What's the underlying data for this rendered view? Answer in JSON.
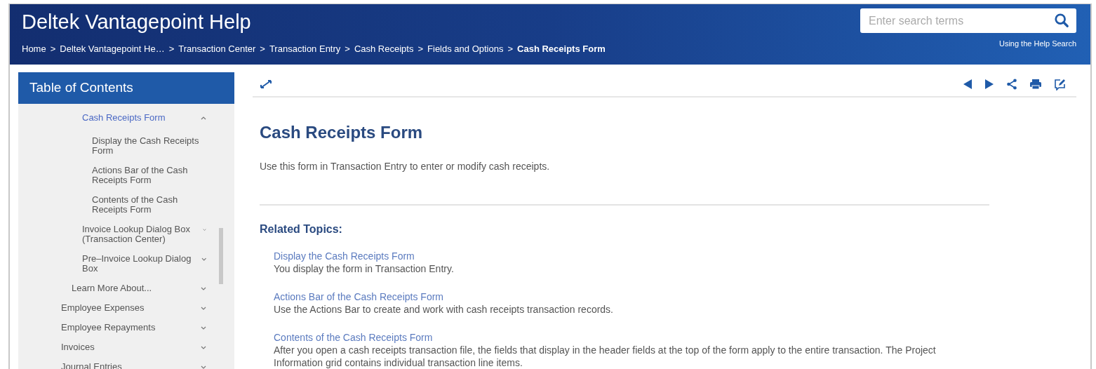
{
  "header": {
    "title": "Deltek Vantagepoint Help",
    "search": {
      "placeholder": "Enter search terms"
    },
    "search_help_link": "Using the Help Search"
  },
  "breadcrumbs": [
    {
      "label": "Home",
      "current": false
    },
    {
      "label": "Deltek Vantagepoint He…",
      "current": false
    },
    {
      "label": "Transaction Center",
      "current": false
    },
    {
      "label": "Transaction Entry",
      "current": false
    },
    {
      "label": "Cash Receipts",
      "current": false
    },
    {
      "label": "Fields and Options",
      "current": false
    },
    {
      "label": "Cash Receipts Form",
      "current": true
    }
  ],
  "breadcrumb_separator": ">",
  "sidebar": {
    "title": "Table of Contents",
    "items": [
      {
        "children": [
          {
            "children": [
              {
                "label": "Cash Receipts Form",
                "expanded": true,
                "selected": true,
                "children": [
                  {
                    "label": "Display the Cash Receipts Form",
                    "selected": false
                  },
                  {
                    "label": "Actions Bar of the Cash Receipts Form",
                    "selected": false
                  },
                  {
                    "label": "Contents of the Cash Receipts Form",
                    "selected": false
                  }
                ]
              },
              {
                "label": "Invoice Lookup Dialog Box (Transaction Center)",
                "expanded": false,
                "selected": false
              },
              {
                "label": "Pre–Invoice Lookup Dialog Box",
                "expanded": false,
                "selected": false
              }
            ]
          },
          {
            "label": "Learn More About...",
            "expanded": false,
            "selected": false
          }
        ]
      },
      {
        "label": "Employee Expenses",
        "expanded": false,
        "selected": false
      },
      {
        "label": "Employee Repayments",
        "expanded": false,
        "selected": false
      },
      {
        "label": "Invoices",
        "expanded": false,
        "selected": false
      },
      {
        "label": "Journal Entries",
        "expanded": false,
        "selected": false
      }
    ]
  },
  "article": {
    "title": "Cash Receipts Form",
    "intro": "Use this form in Transaction Entry to enter or modify cash receipts.",
    "related_heading": "Related Topics:",
    "related": [
      {
        "link": "Display the Cash Receipts Form",
        "description": "You display the form in Transaction Entry."
      },
      {
        "link": "Actions Bar of the Cash Receipts Form",
        "description": "Use the Actions Bar to create and work with cash receipts transaction records."
      },
      {
        "link": "Contents of the Cash Receipts Form",
        "description": "After you open a cash receipts transaction file, the fields that display in the header fields at the top of the form apply to the entire transaction. The Project Information grid contains individual transaction line items."
      }
    ]
  }
}
